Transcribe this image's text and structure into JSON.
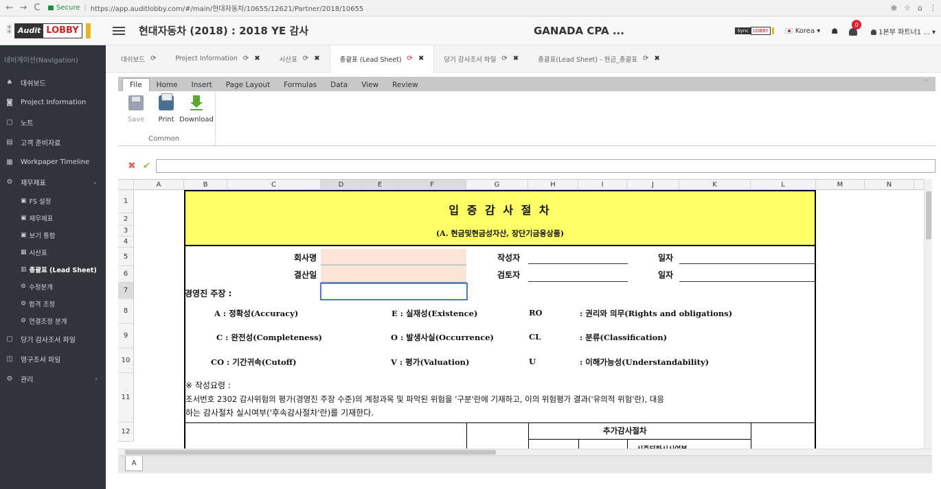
{
  "browser": {
    "back": "←",
    "forward": "→",
    "reload": "C",
    "secure_label": "Secure",
    "url": "https://app.auditlobby.com/#/main/현대자동차/10655/12621/Partner/2018/10655",
    "right_icons": [
      "⊕",
      "☆",
      "⌂",
      "⋮"
    ]
  },
  "header": {
    "logo_mark": "⁑",
    "logo_audit": "Audit",
    "logo_lobby": "LOBBY",
    "title": "현대자동차 (2018) : 2018 YE 감사",
    "firm": "GANADA CPA ...",
    "sync_a": "Sync",
    "sync_b": "LOBBY",
    "language": "Korea ▾",
    "notification_count": "0",
    "user": "1본부 파트너1 ... ▾"
  },
  "sidebar": {
    "heading": "네비게이션(Navigation)",
    "items": [
      {
        "icon": "home-icon",
        "glyph": "♠",
        "label": "대쉬보드"
      },
      {
        "icon": "info-icon",
        "glyph": "◙",
        "label": "Project Information"
      },
      {
        "icon": "note-icon",
        "glyph": "▢",
        "label": "노트"
      },
      {
        "icon": "client-icon",
        "glyph": "▤",
        "label": "고객 준비자료"
      },
      {
        "icon": "calendar-icon",
        "glyph": "▦",
        "label": "Workpaper Timeline"
      },
      {
        "icon": "finance-icon",
        "glyph": "⚙",
        "label": "재무제표",
        "arrow": "⌄"
      }
    ],
    "subitems": [
      {
        "glyph": "▣",
        "label": "FS 설정"
      },
      {
        "glyph": "▣",
        "label": "재무제표"
      },
      {
        "glyph": "▣",
        "label": "보기 통합"
      },
      {
        "glyph": "▦",
        "label": "시산표"
      },
      {
        "glyph": "▥",
        "label": "총괄표 (Lead Sheet)",
        "active": true
      },
      {
        "glyph": "⚙",
        "label": "수정분개"
      },
      {
        "glyph": "⚙",
        "label": "합격 조정"
      },
      {
        "glyph": "⚙",
        "label": "연결조정 분개"
      }
    ],
    "items2": [
      {
        "icon": "file-icon",
        "glyph": "▢",
        "label": "당기 감사조서 파일"
      },
      {
        "icon": "archive-icon",
        "glyph": "◫",
        "label": "영구조서 파일"
      },
      {
        "icon": "settings-icon",
        "glyph": "⚙",
        "label": "관리",
        "arrow": "›"
      }
    ]
  },
  "tabs": [
    {
      "label": "대쉬보드",
      "refresh": "⟳",
      "close": ""
    },
    {
      "label": "Project Information",
      "refresh": "⟳",
      "close": "✖"
    },
    {
      "label": "시산표",
      "refresh": "⟳",
      "close": "✖"
    },
    {
      "label": "총괄표 (Lead Sheet)",
      "refresh": "⟳",
      "close": "✖",
      "active": true
    },
    {
      "label": "당기 감사조서 파일",
      "refresh": "⟳",
      "close": "✖"
    },
    {
      "label": "총괄표(Lead Sheet) - 현금_총괄표",
      "refresh": "⟳",
      "close": "✖"
    }
  ],
  "ribbon": {
    "tabs": [
      "File",
      "Home",
      "Insert",
      "Page Layout",
      "Formulas",
      "Data",
      "View",
      "Review"
    ],
    "collapse": "^",
    "buttons": {
      "save": "Save",
      "print": "Print",
      "download": "Download"
    },
    "group_label": "Common"
  },
  "formula": {
    "cancel": "✖",
    "confirm": "✔",
    "value": ""
  },
  "grid": {
    "columns": [
      "A",
      "B",
      "C",
      "D",
      "E",
      "F",
      "G",
      "H",
      "I",
      "J",
      "K",
      "L",
      "M",
      "N"
    ],
    "rows": [
      "1",
      "2",
      "3",
      "4",
      "5",
      "6",
      "7",
      "8",
      "9",
      "10",
      "11",
      "12"
    ]
  },
  "sheet": {
    "title": "입 증 감 사 절 차",
    "subtitle": "(A. 현금및현금성자산, 장단기금융상품)",
    "company_label": "회사명",
    "period_label": "결산일",
    "preparer_label": "작성자",
    "reviewer_label": "검토자",
    "date_label_1": "일자",
    "date_label_2": "일자",
    "assertion_label": "경영진 주장 :",
    "assertions": [
      {
        "text": "A : 정확성(Accuracy)"
      },
      {
        "text": "E : 실재성(Existence)"
      },
      {
        "text": "RO"
      },
      {
        "text": ": 권리와 의무(Rights and obligations)"
      },
      {
        "text": "C : 완전성(Completeness)"
      },
      {
        "text": "O : 발생사실(Occurrence)"
      },
      {
        "text": "CL"
      },
      {
        "text": ": 분류(Classification)"
      },
      {
        "text": "CO : 기간귀속(Cutoff)"
      },
      {
        "text": "V : 평가(Valuation)"
      },
      {
        "text": "U"
      },
      {
        "text": ": 이해가능성(Understandability)"
      }
    ],
    "note_heading": "※ 작성요령 :",
    "note_line1": "조서번호 2302 감사위험의 평가(경영진 주장 수준)의 계정과목 및 파악된 위험을 '구분'란에 기재하고, 이의 위험평가 결과('유의적 위험'란), 대응",
    "note_line2": "하는 감사절차 실시여부('후속감사절차'란)를 기재한다.",
    "extra_procedures": "추가감사절차",
    "partial_header": "시즌되하시시여부"
  },
  "sheet_tab": "A"
}
